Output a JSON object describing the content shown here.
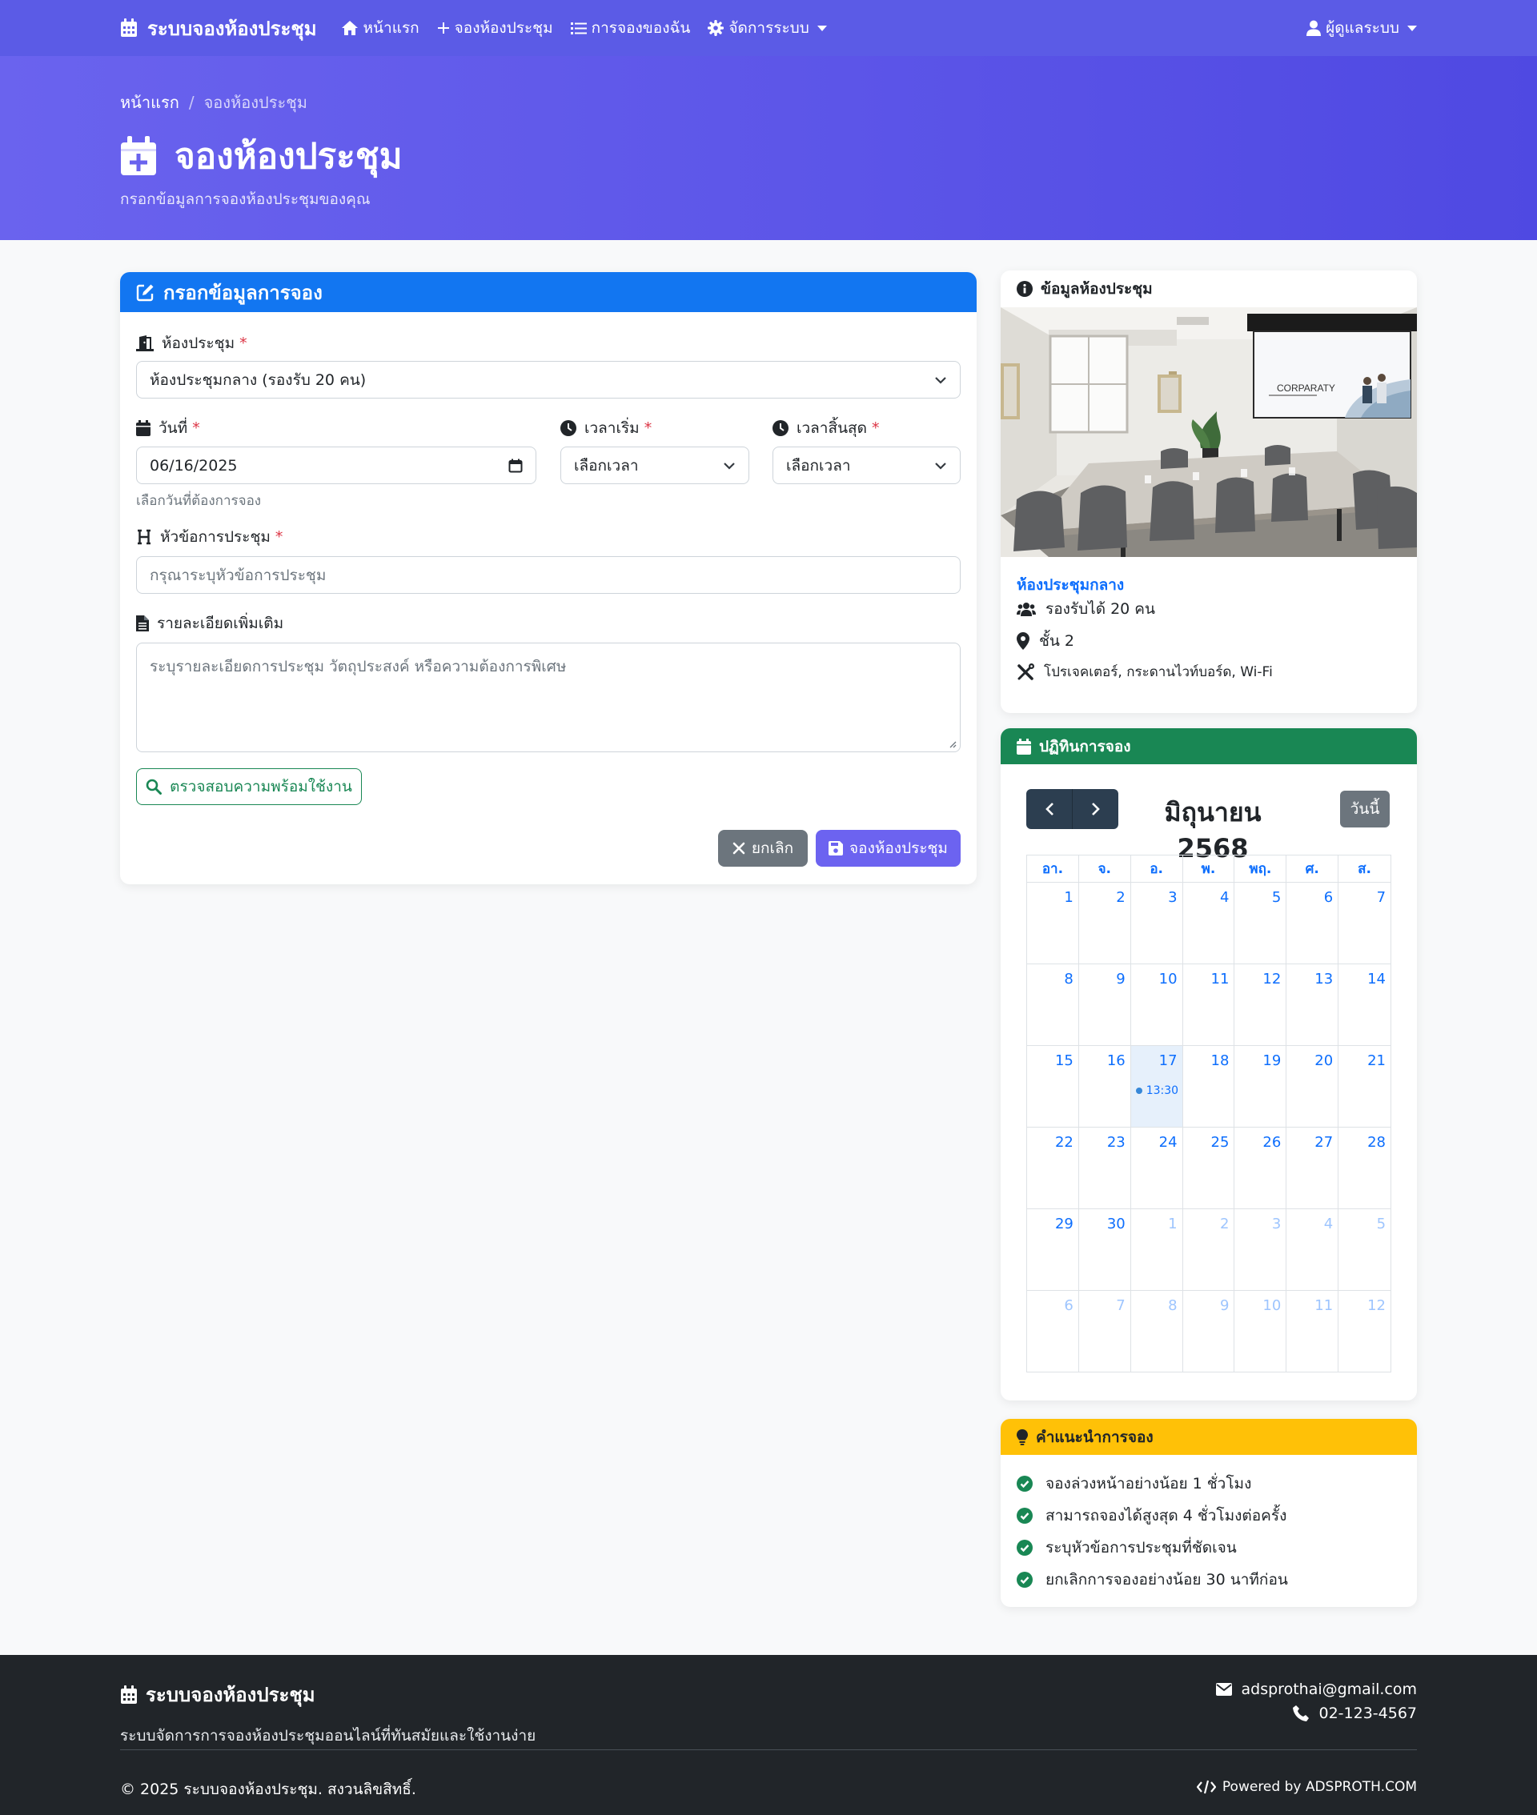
{
  "navbar": {
    "brand": "ระบบจองห้องประชุม",
    "links": [
      "หน้าแรก",
      "จองห้องประชุม",
      "การจองของฉัน",
      "จัดการระบบ"
    ],
    "user": "ผู้ดูแลระบบ"
  },
  "hero": {
    "breadcrumb_home": "หน้าแรก",
    "breadcrumb_sep": "/",
    "breadcrumb_current": "จองห้องประชุม",
    "title": "จองห้องประชุม",
    "subtitle": "กรอกข้อมูลการจองห้องประชุมของคุณ"
  },
  "form": {
    "header": "กรอกข้อมูลการจอง",
    "required_mark": "*",
    "room_label": "ห้องประชุม",
    "room_value": "ห้องประชุมกลาง (รองรับ 20 คน)",
    "date_label": "วันที่",
    "date_value": "06/16/2025",
    "date_help": "เลือกวันที่ต้องการจอง",
    "start_label": "เวลาเริ่ม",
    "start_value": "เลือกเวลา",
    "end_label": "เวลาสิ้นสุด",
    "end_value": "เลือกเวลา",
    "topic_label": "หัวข้อการประชุม",
    "topic_placeholder": "กรุณาระบุหัวข้อการประชุม",
    "detail_label": "รายละเอียดเพิ่มเติม",
    "detail_placeholder": "ระบุรายละเอียดการประชุม วัตถุประสงค์ หรือความต้องการพิเศษ",
    "check_button": "ตรวจสอบความพร้อมใช้งาน",
    "cancel_button": "ยกเลิก",
    "submit_button": "จองห้องประชุม"
  },
  "room_info": {
    "header": "ข้อมูลห้องประชุม",
    "screen_text": "CORPARATY",
    "name": "ห้องประชุมกลาง",
    "capacity": "รองรับได้ 20 คน",
    "floor": "ชั้น 2",
    "equipment": "โปรเจคเตอร์, กระดานไวท์บอร์ด, Wi-Fi"
  },
  "calendar": {
    "header": "ปฏิทินการจอง",
    "month_title": "มิถุนายน 2568",
    "today_button": "วันนี้",
    "weekdays": [
      "อา.",
      "จ.",
      "อ.",
      "พ.",
      "พฤ.",
      "ศ.",
      "ส."
    ],
    "weeks": [
      [
        "1",
        "2",
        "3",
        "4",
        "5",
        "6",
        "7"
      ],
      [
        "8",
        "9",
        "10",
        "11",
        "12",
        "13",
        "14"
      ],
      [
        "15",
        "16",
        "17",
        "18",
        "19",
        "20",
        "21"
      ],
      [
        "22",
        "23",
        "24",
        "25",
        "26",
        "27",
        "28"
      ],
      [
        "29",
        "30",
        "1",
        "2",
        "3",
        "4",
        "5"
      ],
      [
        "6",
        "7",
        "8",
        "9",
        "10",
        "11",
        "12"
      ]
    ],
    "today_day": "17",
    "event_time": "13:30",
    "event_color": "#3788d8"
  },
  "tips": {
    "header": "คำแนะนำการจอง",
    "items": [
      "จองล่วงหน้าอย่างน้อย 1 ชั่วโมง",
      "สามารถจองได้สูงสุด 4 ชั่วโมงต่อครั้ง",
      "ระบุหัวข้อการประชุมที่ชัดเจน",
      "ยกเลิกการจองอย่างน้อย 30 นาทีก่อน"
    ]
  },
  "footer": {
    "brand": "ระบบจองห้องประชุม",
    "description": "ระบบจัดการการจองห้องประชุมออนไลน์ที่ทันสมัยและใช้งานง่าย",
    "email": "adsprothai@gmail.com",
    "phone": "02-123-4567",
    "copyright": "© 2025 ระบบจองห้องประชุม. สงวนลิขสิทธิ์.",
    "powered": "Powered by ADSPROTH.COM"
  },
  "colors": {
    "nav": "#5b5be6",
    "primary_header": "#1276f1",
    "calendar_header": "#198754",
    "tips_header": "#ffc107",
    "footer": "#212529"
  }
}
